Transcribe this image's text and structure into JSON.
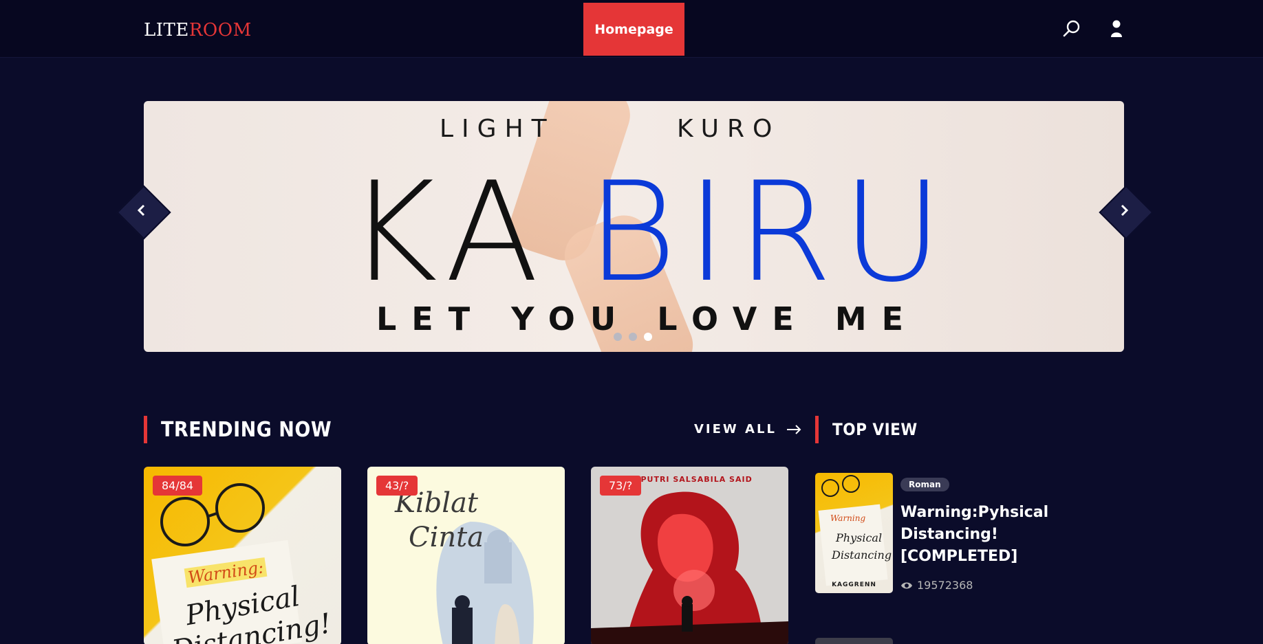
{
  "header": {
    "logo_part1": "LITE",
    "logo_part2": "ROOM",
    "nav_home": "Homepage",
    "icons": [
      "search-icon",
      "user-icon"
    ]
  },
  "hero": {
    "author_left": "LIGHT",
    "author_right": "KURO",
    "title_left": "KA",
    "title_right": "BIRU",
    "tagline": "LET YOU LOVE ME",
    "slides_count": 3,
    "active_slide": 3,
    "icons": [
      "chevron-left-icon",
      "chevron-right-icon"
    ]
  },
  "trending": {
    "title": "TRENDING NOW",
    "view_all": "VIEW ALL",
    "cards": [
      {
        "badge": "84/84",
        "cover_text_1": "Warning:",
        "cover_text_2": "Physical",
        "cover_text_3": "Distancing!"
      },
      {
        "badge": "43/?",
        "cover_text_1": "Kiblat",
        "cover_text_2": "Cinta"
      },
      {
        "badge": "73/?",
        "cover_text_1": "YAH PUTRI SALSABILA SAID"
      }
    ]
  },
  "top_view": {
    "title": "TOP VIEW",
    "items": [
      {
        "genre": "Roman",
        "title": "Warning:Pyhsical Distancing! [COMPLETED]",
        "views": "19572368",
        "thumb_author": "KAGGRENN"
      }
    ]
  },
  "colors": {
    "background": "#0b0c2a",
    "header": "#070720",
    "accent": "#e53637",
    "hero_blue": "#0b3ad8"
  }
}
